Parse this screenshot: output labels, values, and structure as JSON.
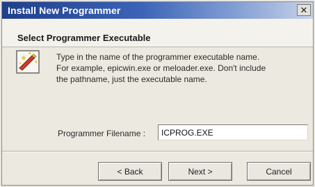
{
  "window": {
    "title": "Install New Programmer",
    "close_glyph": "✕"
  },
  "header": {
    "title": "Select Programmer Executable"
  },
  "body": {
    "icon": "wizard-wand-icon",
    "description_lines": [
      "Type in the name of the programmer executable name.",
      "For example, epicwin.exe or meloader.exe.  Don't include",
      "the pathname, just the executable name."
    ]
  },
  "form": {
    "filename_label": "Programmer Filename :",
    "filename_value": "ICPROG.EXE"
  },
  "buttons": {
    "back": "< Back",
    "next": "Next >",
    "cancel": "Cancel"
  }
}
